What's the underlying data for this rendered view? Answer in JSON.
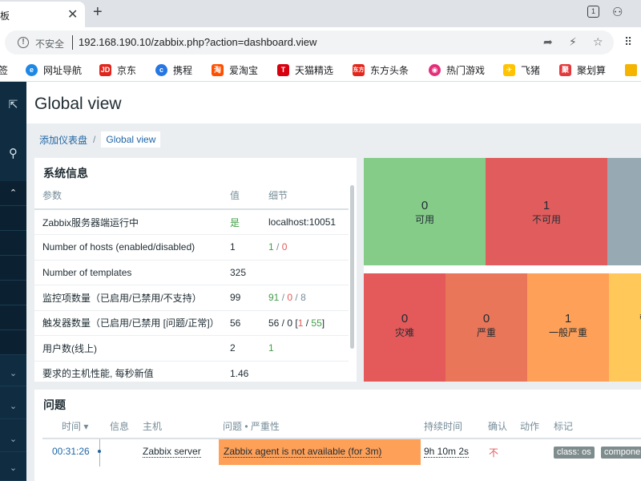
{
  "browser": {
    "tab_title": "板",
    "address_security": "不安全",
    "url": "192.168.190.10/zabbix.php?action=dashboard.view",
    "bookmarks": [
      {
        "label": "签",
        "icon": "bookmark-folder-icon"
      },
      {
        "label": "网址导航",
        "icon": "ie-icon",
        "color": "#1e88e5"
      },
      {
        "label": "京东",
        "icon": "jd-icon",
        "color": "#e1251b",
        "glyph": "JD"
      },
      {
        "label": "携程",
        "icon": "ctrip-icon",
        "color": "#2577e3"
      },
      {
        "label": "爱淘宝",
        "icon": "aitaobao-icon",
        "color": "#ff5000",
        "glyph": "淘"
      },
      {
        "label": "天猫精选",
        "icon": "tmall-icon",
        "color": "#d8000f",
        "glyph": "T"
      },
      {
        "label": "东方头条",
        "icon": "dongfang-icon",
        "color": "#e3261c",
        "glyph": "东方"
      },
      {
        "label": "热门游戏",
        "icon": "game-icon",
        "color": "#e52e7a"
      },
      {
        "label": "飞猪",
        "icon": "fliggy-icon",
        "color": "#ffc300"
      },
      {
        "label": "聚划算",
        "icon": "juhuasuan-icon",
        "color": "#e4393c",
        "glyph": "聚"
      }
    ]
  },
  "page": {
    "title": "Global view",
    "breadcrumb_parent": "添加仪表盘",
    "breadcrumb_current": "Global view"
  },
  "system_info": {
    "title": "系统信息",
    "headers": [
      "参数",
      "值",
      "细节"
    ],
    "rows": [
      {
        "param": "Zabbix服务器端运行中",
        "value": "是",
        "value_class": "green",
        "detail": [
          {
            "t": "localhost:10051",
            "c": ""
          }
        ]
      },
      {
        "param": "Number of hosts (enabled/disabled)",
        "value": "1",
        "value_class": "",
        "detail": [
          {
            "t": "1",
            "c": "green"
          },
          {
            "t": " / ",
            "c": "grey"
          },
          {
            "t": "0",
            "c": "red"
          }
        ]
      },
      {
        "param": "Number of templates",
        "value": "325",
        "value_class": "",
        "detail": []
      },
      {
        "param": "监控项数量（已启用/已禁用/不支持）",
        "value": "99",
        "value_class": "",
        "detail": [
          {
            "t": "91",
            "c": "green"
          },
          {
            "t": " / ",
            "c": "grey"
          },
          {
            "t": "0",
            "c": "red"
          },
          {
            "t": " / ",
            "c": "grey"
          },
          {
            "t": "8",
            "c": "grey"
          }
        ]
      },
      {
        "param": "触发器数量（已启用/已禁用 [问题/正常]）",
        "value": "56",
        "value_class": "",
        "detail": [
          {
            "t": "56 / 0 [",
            "c": ""
          },
          {
            "t": "1",
            "c": "red"
          },
          {
            "t": " / ",
            "c": ""
          },
          {
            "t": "55",
            "c": "green"
          },
          {
            "t": "]",
            "c": ""
          }
        ]
      },
      {
        "param": "用户数(线上)",
        "value": "2",
        "value_class": "",
        "detail": [
          {
            "t": "1",
            "c": "green"
          }
        ]
      },
      {
        "param": "要求的主机性能, 每秒新值",
        "value": "1.46",
        "value_class": "",
        "detail": []
      }
    ]
  },
  "host_availability": [
    {
      "count": "0",
      "label": "可用",
      "color": "#86cc89"
    },
    {
      "count": "1",
      "label": "不可用",
      "color": "#e15d5d"
    },
    {
      "count": "",
      "label": "",
      "color": "#97aab3"
    }
  ],
  "problems_by_severity": [
    {
      "count": "0",
      "label": "灾难",
      "color": "#e45959"
    },
    {
      "count": "0",
      "label": "严重",
      "color": "#e97659"
    },
    {
      "count": "1",
      "label": "一般严重",
      "color": "#ffa059"
    },
    {
      "count": "",
      "label": "警",
      "color": "#ffc859"
    }
  ],
  "problems": {
    "title": "问题",
    "headers": [
      "时间 ▾",
      "信息",
      "主机",
      "问题 • 严重性",
      "持续时间",
      "确认",
      "动作",
      "标记"
    ],
    "rows": [
      {
        "time": "00:31:26",
        "host": "Zabbix server",
        "problem": "Zabbix agent is not available (for 3m)",
        "problem_color": "#ffa059",
        "duration": "9h 10m 2s",
        "ack": "不",
        "tags": [
          "class: os",
          "compone"
        ]
      }
    ]
  },
  "sidebar": {
    "items": [
      "",
      "",
      "",
      "",
      "",
      "",
      "",
      ""
    ]
  }
}
